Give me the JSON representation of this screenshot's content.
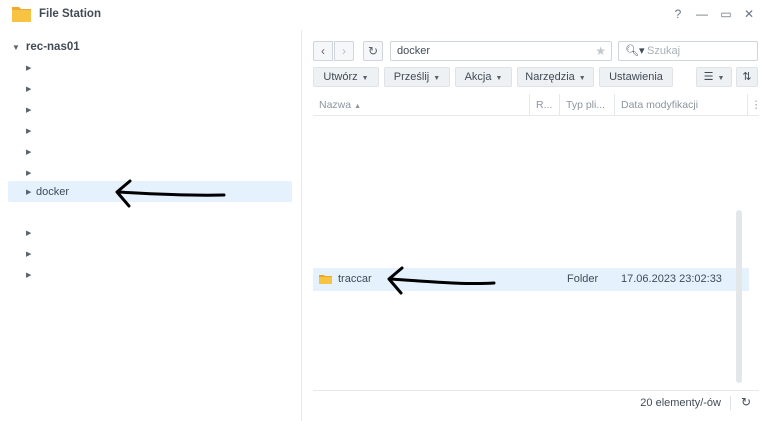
{
  "window": {
    "title": "File Station",
    "controls": {
      "help": "?",
      "minimize": "—",
      "maximize": "▭",
      "close": "✕"
    }
  },
  "tree": {
    "root_label": "rec-nas01",
    "items": [
      {
        "label": ""
      },
      {
        "label": ""
      },
      {
        "label": ""
      },
      {
        "label": ""
      },
      {
        "label": ""
      },
      {
        "label": ""
      },
      {
        "label": "docker",
        "selected": true
      },
      {
        "label": ""
      },
      {
        "label": ""
      },
      {
        "label": ""
      }
    ]
  },
  "toolbar": {
    "path": "docker",
    "search_placeholder": "Szukaj",
    "create": "Utwórz",
    "upload": "Prześlij",
    "action": "Akcja",
    "tools": "Narzędzia",
    "settings": "Ustawienia"
  },
  "grid": {
    "columns": [
      "Nazwa",
      "R...",
      "Typ pli...",
      "Data modyfikacji"
    ],
    "rows": [
      {
        "name": "traccar",
        "type": "Folder",
        "modified": "17.06.2023 23:02:33",
        "icon": "folder-icon"
      }
    ]
  },
  "status": {
    "count_text": "20 elementy/-ów"
  },
  "colors": {
    "selection": "#e5f1fc",
    "folder": "#f6c342",
    "accent": "#2b7bd1"
  }
}
